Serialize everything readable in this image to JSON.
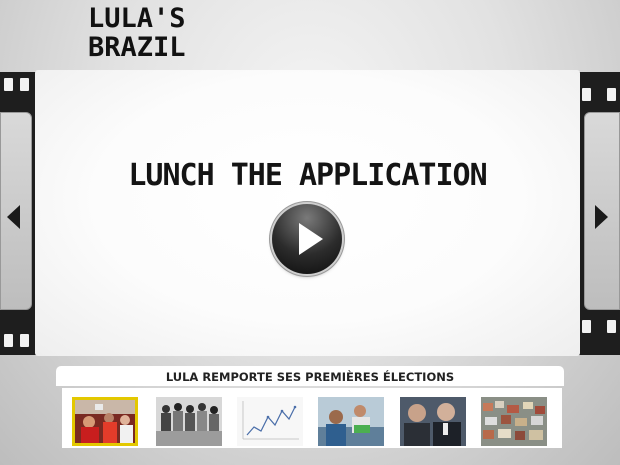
{
  "logo": {
    "line1": "LULA'S",
    "line2": "BRAZIL"
  },
  "hero": {
    "headline": "LUNCH THE APPLICATION"
  },
  "caption": "LULA REMPORTE SES PREMIÈRES ÉLECTIONS",
  "thumbnails": [
    "photo-crowd",
    "photo-group",
    "line-chart",
    "photo-classroom",
    "photo-handshake",
    "photo-favela"
  ],
  "colors": {
    "accent": "#e3c800",
    "film": "#1e1e1e"
  }
}
